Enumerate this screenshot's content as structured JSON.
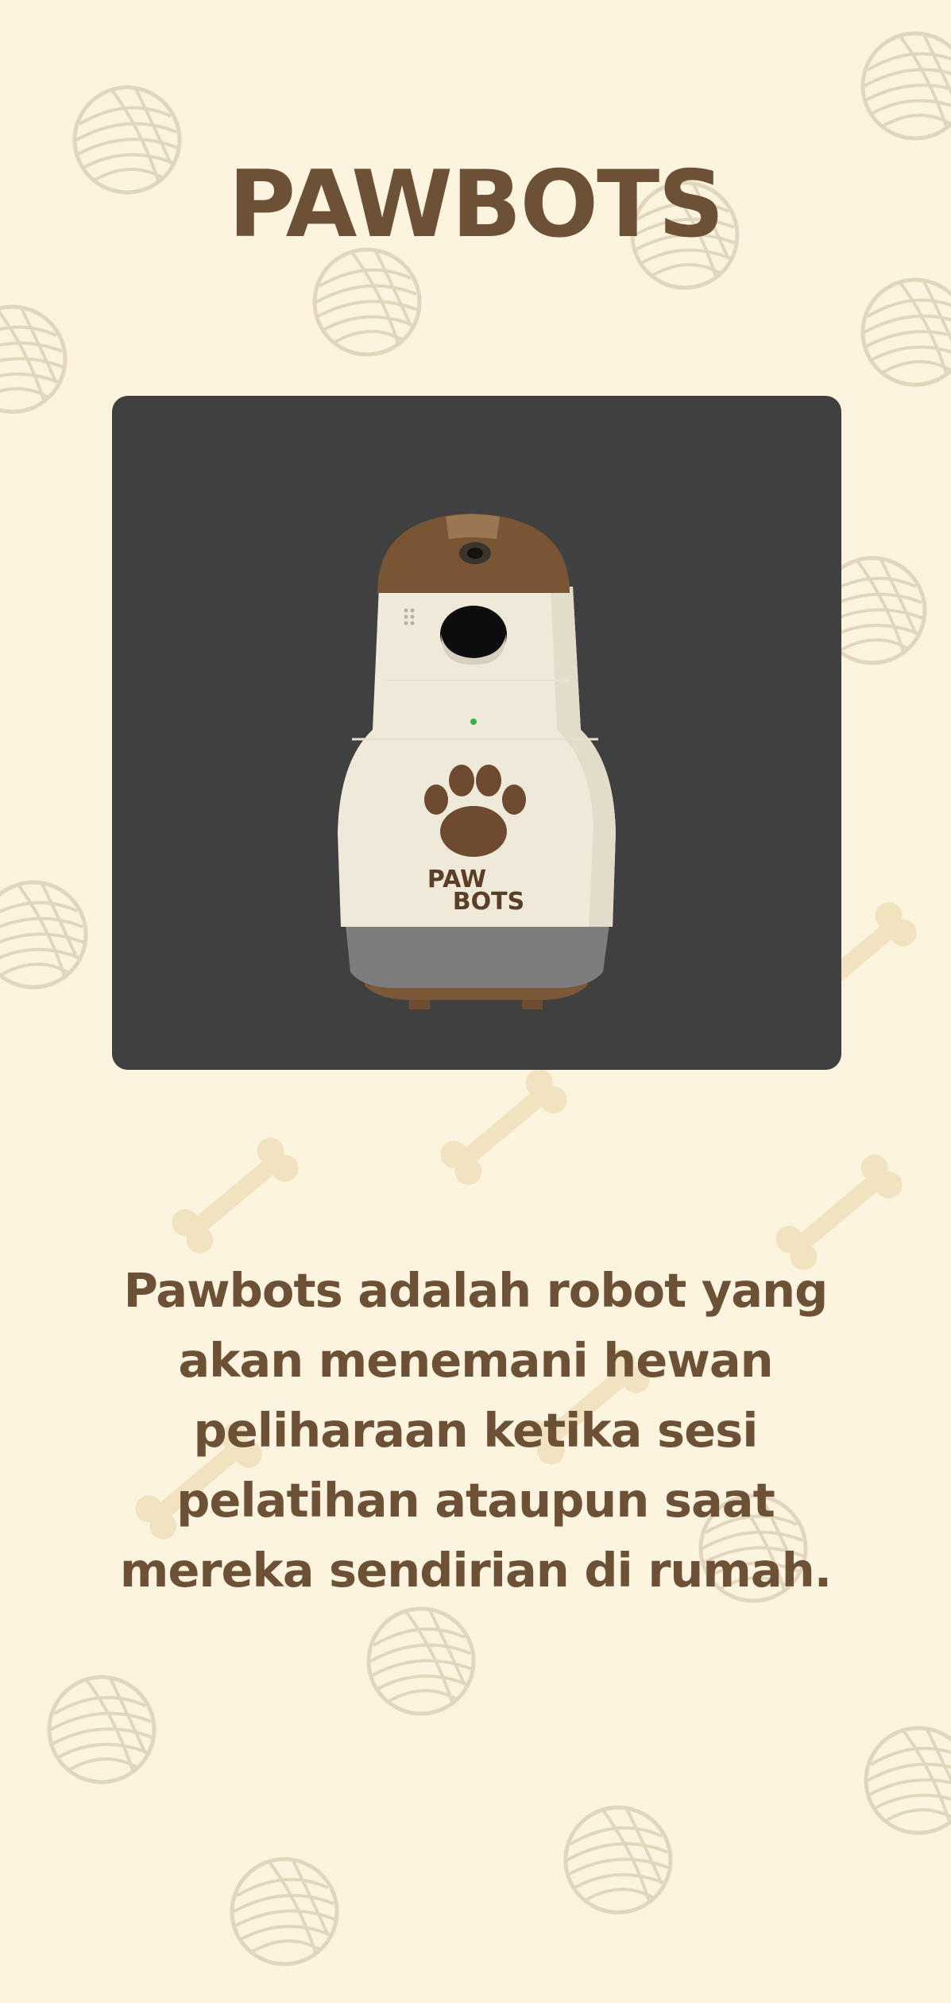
{
  "app": {
    "title": "PAWBOTS",
    "description": "Pawbots adalah robot yang akan menemani hewan peliharaan ketika sesi pelatihan ataupun saat mereka sendirian di rumah."
  },
  "product": {
    "logo_text_line1": "PAW",
    "logo_text_line2": "BOTS"
  },
  "colors": {
    "background": "#fdf4df",
    "brand_brown": "#6d5136",
    "viewer_background": "#404040",
    "pattern_yarn": "#e7dcc4",
    "pattern_bone": "#f1e3c2"
  },
  "icons": [
    "yarn-ball-icon",
    "bone-icon",
    "paw-icon"
  ]
}
